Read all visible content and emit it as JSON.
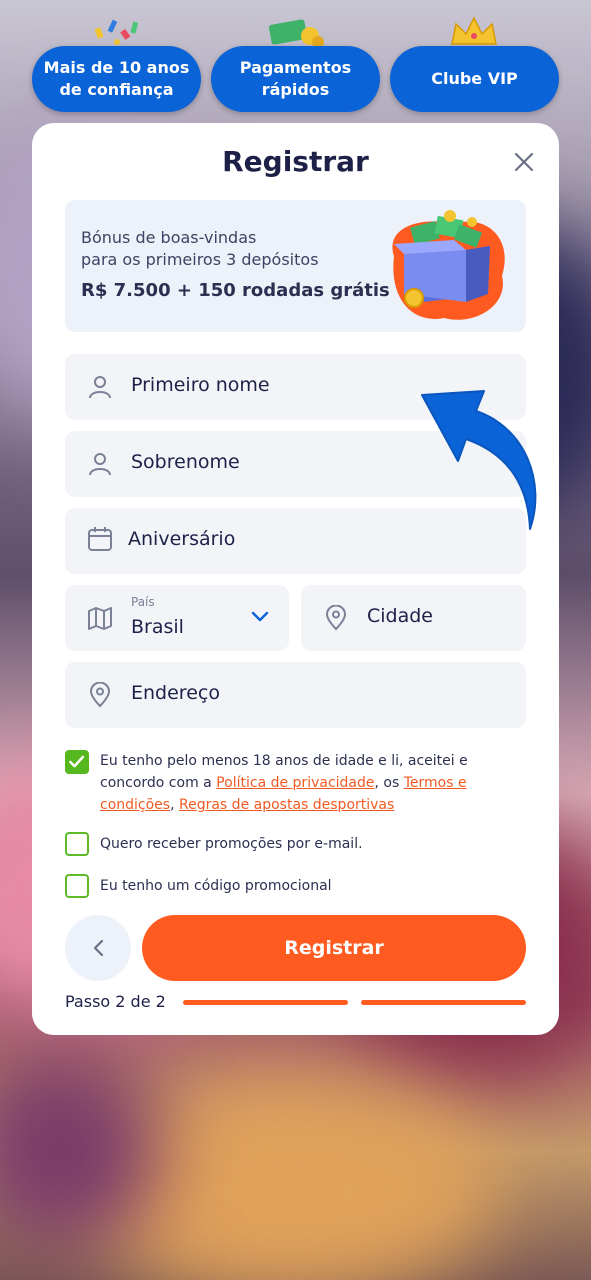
{
  "badges": [
    {
      "line1": "Mais de 10 anos",
      "line2": "de confiança"
    },
    {
      "line1": "Pagamentos",
      "line2": "rápidos"
    },
    {
      "line1": "Clube VIP",
      "line2": ""
    }
  ],
  "modal": {
    "title": "Registrar",
    "close_icon": "close-icon"
  },
  "promo": {
    "line1": "Bónus de boas-vindas",
    "line2": "para os primeiros 3 depósitos",
    "amount": "R$ 7.500 + 150 rodadas grátis"
  },
  "fields": {
    "first_name": {
      "placeholder": "Primeiro nome",
      "icon": "user-icon"
    },
    "last_name": {
      "placeholder": "Sobrenome",
      "icon": "user-icon"
    },
    "birthday": {
      "placeholder": "Aniversário",
      "icon": "calendar-icon"
    },
    "country": {
      "caption": "País",
      "value": "Brasil",
      "icon": "map-icon"
    },
    "city": {
      "placeholder": "Cidade",
      "icon": "location-pin-icon"
    },
    "address": {
      "placeholder": "Endereço",
      "icon": "location-pin-icon"
    }
  },
  "checks": {
    "terms": {
      "checked": true,
      "text_before": "Eu tenho pelo menos 18 anos de idade e li, aceitei e concordo com a ",
      "privacy_link": "Política de privacidade",
      "sep1": ", os ",
      "terms_link": "Termos e condições",
      "sep2": ", ",
      "rules_link": "Regras de apostas desportivas"
    },
    "promo_email": {
      "checked": false,
      "text": "Quero receber promoções por e-mail."
    },
    "promo_code": {
      "checked": false,
      "text": "Eu tenho um código promocional"
    }
  },
  "footer": {
    "submit_label": "Registrar",
    "step_text": "Passo 2 de 2"
  },
  "colors": {
    "accent_blue": "#0b63d8",
    "accent_orange": "#ff5a1f",
    "check_green": "#55b81f",
    "title_navy": "#1d2148"
  }
}
